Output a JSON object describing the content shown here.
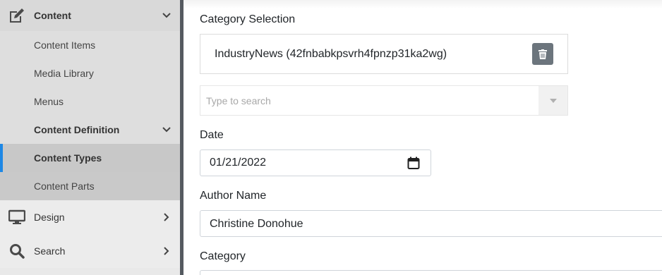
{
  "sidebar": {
    "content": {
      "label": "Content",
      "icon": "edit-icon",
      "chevron": "chevron-down-icon"
    },
    "sub_items": [
      {
        "label": "Content Items"
      },
      {
        "label": "Media Library"
      },
      {
        "label": "Menus"
      },
      {
        "label": "Content Definition",
        "chevron": "chevron-down-icon"
      },
      {
        "label": "Content Types",
        "active": true
      },
      {
        "label": "Content Parts"
      }
    ],
    "design": {
      "label": "Design",
      "icon": "monitor-icon",
      "chevron": "chevron-right-icon"
    },
    "search": {
      "label": "Search",
      "icon": "search-icon",
      "chevron": "chevron-right-icon"
    },
    "accent_color": "#1e88e5"
  },
  "form": {
    "category_selection": {
      "label": "Category Selection",
      "selected": "IndustryNews (42fnbabkpsvrh4fpnzp31ka2wg)",
      "delete_icon": "trash-icon",
      "search_placeholder": "Type to search",
      "dropdown_icon": "caret-down-icon"
    },
    "date": {
      "label": "Date",
      "value": "01/21/2022",
      "icon": "calendar-icon"
    },
    "author": {
      "label": "Author Name",
      "value": "Christine Donohue"
    },
    "category": {
      "label": "Category"
    }
  }
}
